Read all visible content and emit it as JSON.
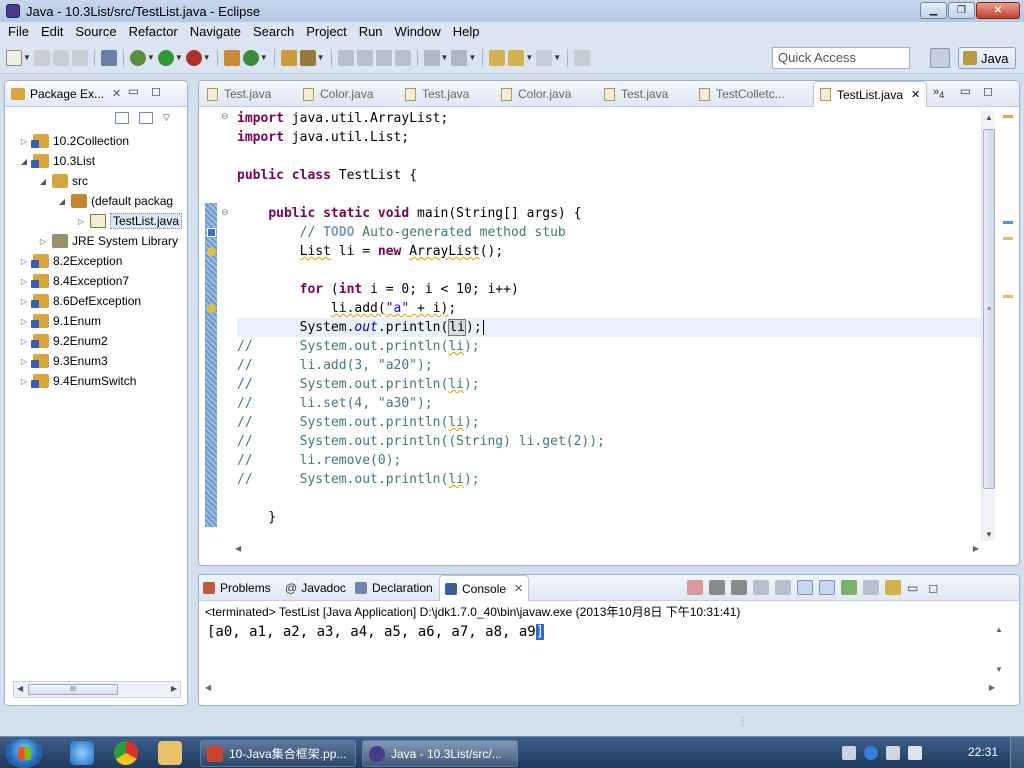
{
  "window": {
    "title": "Java - 10.3List/src/TestList.java - Eclipse"
  },
  "menu": [
    "File",
    "Edit",
    "Source",
    "Refactor",
    "Navigate",
    "Search",
    "Project",
    "Run",
    "Window",
    "Help"
  ],
  "toolbar": {
    "quick_access_placeholder": "Quick Access",
    "perspective_label": "Java"
  },
  "package_explorer": {
    "tab_label": "Package Ex...",
    "tree": [
      {
        "label": "10.2Collection",
        "icon": "project-icon",
        "depth": 0,
        "expanded": false
      },
      {
        "label": "10.3List",
        "icon": "project-icon",
        "depth": 0,
        "expanded": true
      },
      {
        "label": "src",
        "icon": "source-folder-icon",
        "depth": 1,
        "expanded": true
      },
      {
        "label": "(default packag",
        "icon": "package-icon",
        "depth": 2,
        "expanded": true
      },
      {
        "label": "TestList.java",
        "icon": "java-file-icon",
        "depth": 3,
        "expanded": false,
        "selected": true
      },
      {
        "label": "JRE System Library",
        "icon": "library-icon",
        "depth": 1,
        "expanded": false
      },
      {
        "label": "8.2Exception",
        "icon": "project-icon",
        "depth": 0,
        "expanded": false
      },
      {
        "label": "8.4Exception7",
        "icon": "project-icon",
        "depth": 0,
        "expanded": false
      },
      {
        "label": "8.6DefException",
        "icon": "project-icon",
        "depth": 0,
        "expanded": false
      },
      {
        "label": "9.1Enum",
        "icon": "project-icon",
        "depth": 0,
        "expanded": false
      },
      {
        "label": "9.2Enum2",
        "icon": "project-icon",
        "depth": 0,
        "expanded": false
      },
      {
        "label": "9.3Enum3",
        "icon": "project-icon",
        "depth": 0,
        "expanded": false
      },
      {
        "label": "9.4EnumSwitch",
        "icon": "project-icon",
        "depth": 0,
        "expanded": false
      }
    ]
  },
  "editor": {
    "tabs": [
      "Test.java",
      "Color.java",
      "Test.java",
      "Color.java",
      "Test.java",
      "TestColletc...",
      "TestList.java"
    ],
    "active_tab": "TestList.java",
    "overflow_count": "4"
  },
  "console": {
    "tabs": [
      "Problems",
      "Javadoc",
      "Declaration",
      "Console"
    ],
    "active_tab": "Console",
    "status": "<terminated> TestList [Java Application] D:\\jdk1.7.0_40\\bin\\javaw.exe (2013年10月8日 下午10:31:41)",
    "output_main": "[a0, a1, a2, a3, a4, a5, a6, a7, a8, a9",
    "output_selected": "]"
  },
  "taskbar": {
    "items": [
      {
        "label": "10-Java集合框架.pp...",
        "active": false
      },
      {
        "label": "Java - 10.3List/src/...",
        "active": true
      }
    ],
    "clock": "22:31"
  },
  "colors": {
    "keyword": "#7f0055",
    "comment": "#3f7f5f",
    "string": "#2a00ff",
    "accent": "#3068d0"
  }
}
